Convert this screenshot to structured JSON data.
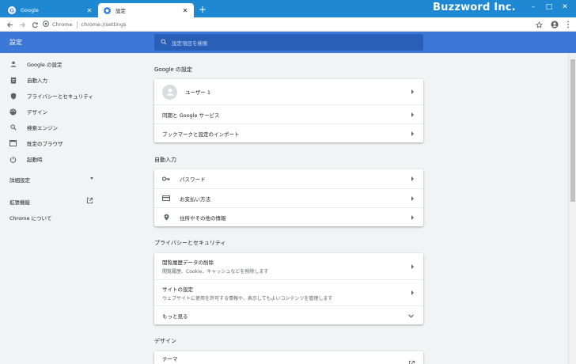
{
  "browser": {
    "tabs": [
      {
        "title": "Google",
        "icon": "google-g-icon"
      },
      {
        "title": "設定",
        "icon": "gear-icon"
      }
    ],
    "new_tab": "+",
    "brand": "Buzzword Inc.",
    "omnibox": {
      "site": "Chrome",
      "url": "chrome://settings"
    }
  },
  "settings": {
    "title": "設定",
    "search_placeholder": "設定項目を検索",
    "sidebar": [
      {
        "label": "Google の設定",
        "icon": "person-icon"
      },
      {
        "label": "自動入力",
        "icon": "clipboard-icon"
      },
      {
        "label": "プライバシーとセキュリティ",
        "icon": "shield-icon"
      },
      {
        "label": "デザイン",
        "icon": "palette-icon"
      },
      {
        "label": "検索エンジン",
        "icon": "search-icon"
      },
      {
        "label": "既定のブラウザ",
        "icon": "browser-icon"
      },
      {
        "label": "起動時",
        "icon": "power-icon"
      }
    ],
    "advanced": "詳細設定",
    "extensions": "拡張機能",
    "about": "Chrome について",
    "sections": {
      "google": {
        "title": "Google の設定",
        "user": "ユーザー 1",
        "sync": "同期と Google サービス",
        "import": "ブックマークと設定のインポート"
      },
      "autofill": {
        "title": "自動入力",
        "passwords": "パスワード",
        "payments": "お支払い方法",
        "addresses": "住所やその他の情報"
      },
      "privacy": {
        "title": "プライバシーとセキュリティ",
        "clear_title": "閲覧履歴データの削除",
        "clear_sub": "閲覧履歴、Cookie、キャッシュなどを削除します",
        "site_title": "サイトの設定",
        "site_sub": "ウェブサイトに使用を許可する情報や、表示してもよいコンテンツを管理します",
        "more": "もっと見る"
      },
      "appearance": {
        "title": "デザイン",
        "theme": "テーマ"
      }
    }
  }
}
